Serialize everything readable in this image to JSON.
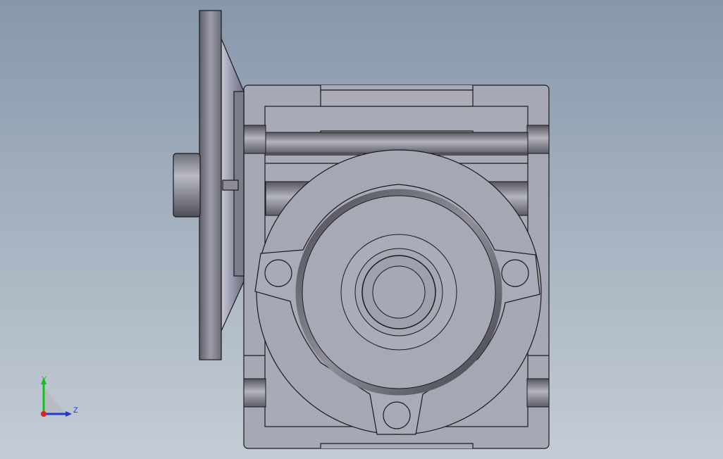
{
  "viewport": {
    "background_top": "#8798ab",
    "background_bottom": "#c4ccd5"
  },
  "model": {
    "body_color": "#a7a8b5",
    "edge_color": "#1a1a1a",
    "shadow_color": "#5a5a63"
  },
  "triad": {
    "x_color": "#e0201b",
    "y_color": "#15c21b",
    "z_color": "#1d3bd4",
    "y_label": "Y",
    "z_label": "Z"
  }
}
